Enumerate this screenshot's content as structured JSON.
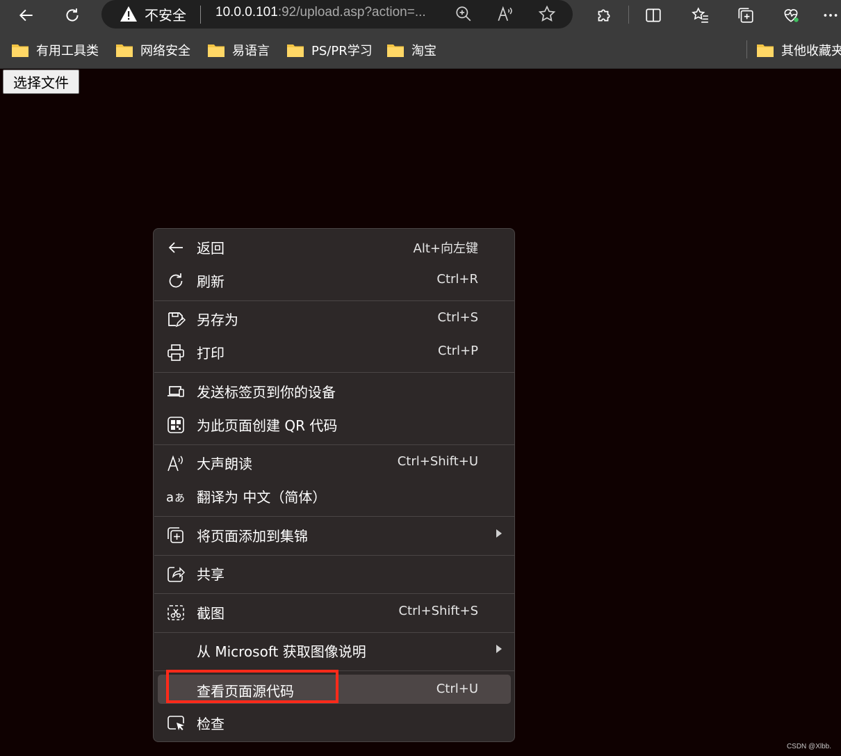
{
  "toolbar": {
    "security_label": "不安全",
    "url_host": "10.0.0.101",
    "url_rest": ":92/upload.asp?action=..."
  },
  "bookmarks": [
    {
      "label": "有用工具类"
    },
    {
      "label": "网络安全"
    },
    {
      "label": "易语言"
    },
    {
      "label": "PS/PR学习"
    },
    {
      "label": "淘宝"
    },
    {
      "label": "其他收藏夹"
    }
  ],
  "page": {
    "file_button": "选择文件"
  },
  "context_menu": {
    "items": [
      {
        "label": "返回",
        "shortcut": "Alt+向左键",
        "icon": "back-arrow-icon"
      },
      {
        "label": "刷新",
        "shortcut": "Ctrl+R",
        "icon": "refresh-icon"
      },
      {
        "label": "另存为",
        "shortcut": "Ctrl+S",
        "icon": "save-as-icon"
      },
      {
        "label": "打印",
        "shortcut": "Ctrl+P",
        "icon": "printer-icon"
      },
      {
        "label": "发送标签页到你的设备",
        "shortcut": "",
        "icon": "send-to-device-icon"
      },
      {
        "label": "为此页面创建 QR 代码",
        "shortcut": "",
        "icon": "qr-code-icon"
      },
      {
        "label": "大声朗读",
        "shortcut": "Ctrl+Shift+U",
        "icon": "read-aloud-icon"
      },
      {
        "label": "翻译为 中文（简体）",
        "shortcut": "",
        "icon": "translate-icon"
      },
      {
        "label": "将页面添加到集锦",
        "shortcut": "",
        "icon": "collections-add-icon"
      },
      {
        "label": "共享",
        "shortcut": "",
        "icon": "share-icon"
      },
      {
        "label": "截图",
        "shortcut": "Ctrl+Shift+S",
        "icon": "screenshot-icon"
      },
      {
        "label": "从 Microsoft 获取图像说明",
        "shortcut": "",
        "icon": ""
      },
      {
        "label": "查看页面源代码",
        "shortcut": "Ctrl+U",
        "icon": ""
      },
      {
        "label": "检查",
        "shortcut": "",
        "icon": "inspect-icon"
      }
    ]
  },
  "watermark": "CSDN @Xlbb.",
  "colors": {
    "page_bg": "#0f0101",
    "toolbar_bg": "#3b3b3b",
    "menu_bg": "#2d2828",
    "highlight_bg": "#4d4646",
    "red_box": "#ff2a1a"
  }
}
